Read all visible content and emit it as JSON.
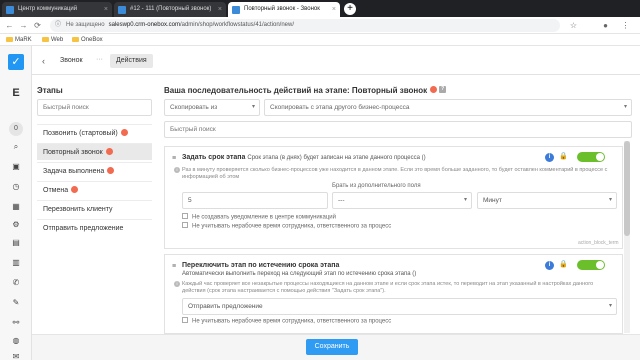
{
  "browser": {
    "tabs": [
      {
        "title": "Центр коммуникаций"
      },
      {
        "title": "#12 - 111 (Повторный звонок)"
      },
      {
        "title": "Повторный звонок - Звонок"
      }
    ],
    "new_tab": "+",
    "url_prefix": "Не защищено",
    "url_host": "saleswp0.crm-onebox.com",
    "url_path": "/admin/shop/workflowstatus/41/action/new/",
    "bookmarks": [
      "MaRK",
      "Web",
      "OneBox"
    ]
  },
  "rail": {
    "logo_check": "✓",
    "letter": "E",
    "counter": "0",
    "icons": [
      "search-icon",
      "briefcase-icon",
      "clock-icon",
      "calendar-icon",
      "settings-icon",
      "grid-icon",
      "book-icon",
      "phone-icon",
      "pen-icon",
      "link-icon",
      "globe-icon",
      "chat-icon"
    ]
  },
  "header": {
    "back": "‹",
    "crumb": "Звонок",
    "dots": "···",
    "action": "Действия"
  },
  "stages": {
    "title": "Этапы",
    "search_placeholder": "Быстрый поиск",
    "items": [
      {
        "label": "Позвонить (стартовый)",
        "badge": true
      },
      {
        "label": "Повторный звонок",
        "badge": true,
        "active": true
      },
      {
        "label": "Задача выполнена",
        "badge": true
      },
      {
        "label": "Отмена",
        "badge": true
      },
      {
        "label": "Перезвонить клиенту",
        "badge": false
      },
      {
        "label": "Отправить предложение",
        "badge": false
      }
    ]
  },
  "main": {
    "title": "Ваша последовательность действий на этапе: Повторный звонок",
    "help": "?",
    "copy_from": "Скопировать из",
    "copy_from_stage": "Скопировать с этапа другого бизнес-процесса",
    "search_placeholder": "Быстрый поиск",
    "card1": {
      "title": "Задать срок этапа",
      "subtitle": "Срок этапа (в днях) будет записан на этапе данного процесса ()",
      "desc1": "Раз в минуту проверяется сколько бизнес-процессов уже находится в данном этапе. Если это время больше заданного, то будет оставлен комментарий в процессе с",
      "desc2": "информацией об этом",
      "field_label": "Брать из дополнительного поля",
      "value": "5",
      "field_value": "---",
      "unit_value": "Минут",
      "check1": "Не создавать уведомление в центре коммуникаций",
      "check2": "Не учитывать нерабочее время сотрудника, ответственного за процесс",
      "tag": "action_block_term"
    },
    "card2": {
      "title": "Переключить этап по истечению срока этапа",
      "subtitle": "Автоматически выполнить переход на следующий этап по истечению срока этапа ()",
      "desc1": "Каждый час проверяет все незакрытые процессы находящиеся на данном этапе и если срок этапа истек, то переводит на этап указанный в настройках данного",
      "desc2": "действия (срок этапа настраивается с помощью действия \"Задать срок этапа\").",
      "select_value": "Отправить предложение",
      "check1": "Не учитывать нерабочее время сотрудника, ответственного за процесс"
    },
    "save": "Сохранить"
  }
}
